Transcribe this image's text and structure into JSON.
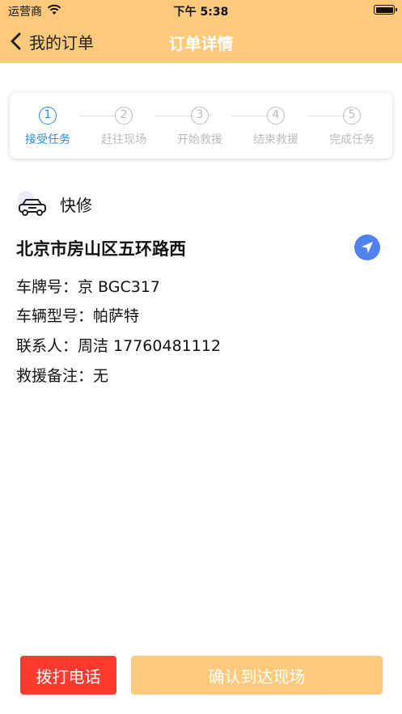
{
  "status_bar": {
    "carrier": "运营商",
    "time": "下午 5:38"
  },
  "nav": {
    "back_label": "我的订单",
    "title": "订单详情"
  },
  "steps": [
    {
      "num": "1",
      "label": "接受任务",
      "active": true
    },
    {
      "num": "2",
      "label": "赶往现场",
      "active": false
    },
    {
      "num": "3",
      "label": "开始救援",
      "active": false
    },
    {
      "num": "4",
      "label": "结束救援",
      "active": false
    },
    {
      "num": "5",
      "label": "完成任务",
      "active": false
    }
  ],
  "order": {
    "service_type": "快修",
    "address": "北京市房山区五环路西",
    "plate": "车牌号：京 BGC317",
    "model": "车辆型号：帕萨特",
    "contact": "联系人：周洁 17760481112",
    "remark": "救援备注：无"
  },
  "actions": {
    "call_label": "拨打电话",
    "confirm_label": "确认到达现场"
  },
  "colors": {
    "header": "#fdc97a",
    "active_step": "#2a8be0",
    "call_button": "#ff3b30",
    "nav_icon": "#4f82ee"
  }
}
